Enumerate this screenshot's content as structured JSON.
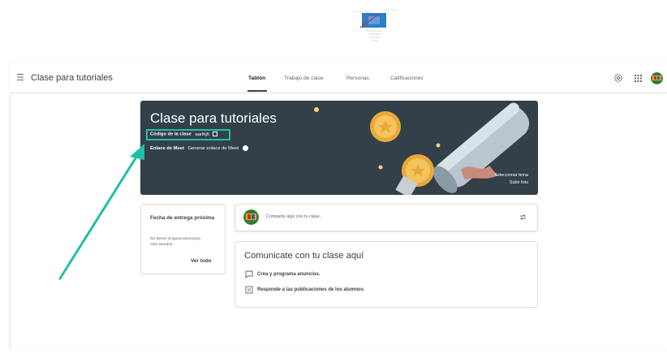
{
  "app": {
    "title": "Clase para tutoriales"
  },
  "tabs": [
    {
      "label": "Tablón",
      "active": true
    },
    {
      "label": "Trabajo de clase",
      "active": false
    },
    {
      "label": "Personas",
      "active": false
    },
    {
      "label": "Calificaciones",
      "active": false
    }
  ],
  "banner": {
    "title": "Clase para tutoriales",
    "class_code_label": "Código de la clase",
    "class_code_value": "aarlhj6",
    "meet_label": "Enlace de Meet",
    "meet_link": "Generar enlace de Meet",
    "select_theme": "Seleccionar tema",
    "upload_photo": "Subir foto"
  },
  "due": {
    "title": "Fecha de entrega próxima",
    "description": "No tienes ninguna tarea para esta semana",
    "view_all": "Ver todo"
  },
  "share": {
    "placeholder": "Comparte algo con tu clase..."
  },
  "communicate": {
    "title": "Comunicate con tu clase aquí",
    "items": [
      {
        "label": "Crea y programa anuncios.",
        "icon": "comment-icon"
      },
      {
        "label": "Responde a las publicaciones de los alumnos",
        "icon": "reply-icon"
      }
    ]
  },
  "colors": {
    "banner": "#334049",
    "highlight": "#1fbfaa",
    "arrow": "#1fbfaa"
  },
  "icons": [
    "menu-icon",
    "gear-icon",
    "apps-icon",
    "avatar",
    "expand-icon",
    "video-icon",
    "repost-icon",
    "comment-icon",
    "reply-icon"
  ]
}
